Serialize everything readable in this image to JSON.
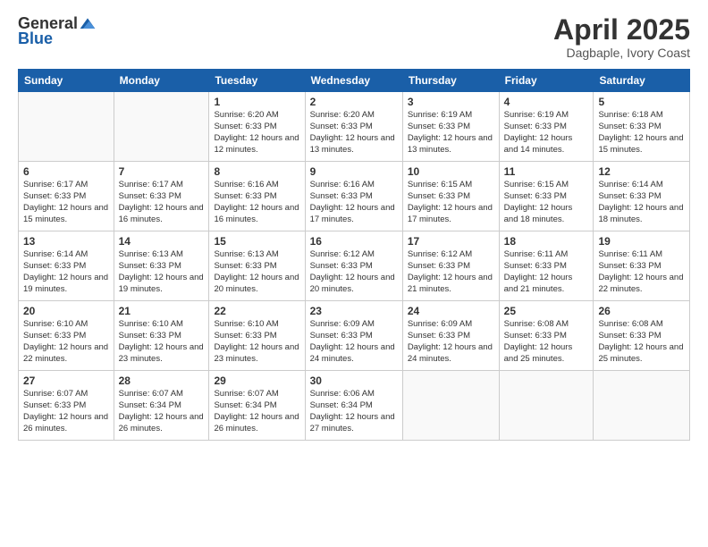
{
  "logo": {
    "general": "General",
    "blue": "Blue"
  },
  "header": {
    "month": "April 2025",
    "location": "Dagbaple, Ivory Coast"
  },
  "weekdays": [
    "Sunday",
    "Monday",
    "Tuesday",
    "Wednesday",
    "Thursday",
    "Friday",
    "Saturday"
  ],
  "weeks": [
    [
      {
        "day": null
      },
      {
        "day": null
      },
      {
        "day": "1",
        "sunrise": "6:20 AM",
        "sunset": "6:33 PM",
        "daylight": "12 hours and 12 minutes."
      },
      {
        "day": "2",
        "sunrise": "6:20 AM",
        "sunset": "6:33 PM",
        "daylight": "12 hours and 13 minutes."
      },
      {
        "day": "3",
        "sunrise": "6:19 AM",
        "sunset": "6:33 PM",
        "daylight": "12 hours and 13 minutes."
      },
      {
        "day": "4",
        "sunrise": "6:19 AM",
        "sunset": "6:33 PM",
        "daylight": "12 hours and 14 minutes."
      },
      {
        "day": "5",
        "sunrise": "6:18 AM",
        "sunset": "6:33 PM",
        "daylight": "12 hours and 15 minutes."
      }
    ],
    [
      {
        "day": "6",
        "sunrise": "6:17 AM",
        "sunset": "6:33 PM",
        "daylight": "12 hours and 15 minutes."
      },
      {
        "day": "7",
        "sunrise": "6:17 AM",
        "sunset": "6:33 PM",
        "daylight": "12 hours and 16 minutes."
      },
      {
        "day": "8",
        "sunrise": "6:16 AM",
        "sunset": "6:33 PM",
        "daylight": "12 hours and 16 minutes."
      },
      {
        "day": "9",
        "sunrise": "6:16 AM",
        "sunset": "6:33 PM",
        "daylight": "12 hours and 17 minutes."
      },
      {
        "day": "10",
        "sunrise": "6:15 AM",
        "sunset": "6:33 PM",
        "daylight": "12 hours and 17 minutes."
      },
      {
        "day": "11",
        "sunrise": "6:15 AM",
        "sunset": "6:33 PM",
        "daylight": "12 hours and 18 minutes."
      },
      {
        "day": "12",
        "sunrise": "6:14 AM",
        "sunset": "6:33 PM",
        "daylight": "12 hours and 18 minutes."
      }
    ],
    [
      {
        "day": "13",
        "sunrise": "6:14 AM",
        "sunset": "6:33 PM",
        "daylight": "12 hours and 19 minutes."
      },
      {
        "day": "14",
        "sunrise": "6:13 AM",
        "sunset": "6:33 PM",
        "daylight": "12 hours and 19 minutes."
      },
      {
        "day": "15",
        "sunrise": "6:13 AM",
        "sunset": "6:33 PM",
        "daylight": "12 hours and 20 minutes."
      },
      {
        "day": "16",
        "sunrise": "6:12 AM",
        "sunset": "6:33 PM",
        "daylight": "12 hours and 20 minutes."
      },
      {
        "day": "17",
        "sunrise": "6:12 AM",
        "sunset": "6:33 PM",
        "daylight": "12 hours and 21 minutes."
      },
      {
        "day": "18",
        "sunrise": "6:11 AM",
        "sunset": "6:33 PM",
        "daylight": "12 hours and 21 minutes."
      },
      {
        "day": "19",
        "sunrise": "6:11 AM",
        "sunset": "6:33 PM",
        "daylight": "12 hours and 22 minutes."
      }
    ],
    [
      {
        "day": "20",
        "sunrise": "6:10 AM",
        "sunset": "6:33 PM",
        "daylight": "12 hours and 22 minutes."
      },
      {
        "day": "21",
        "sunrise": "6:10 AM",
        "sunset": "6:33 PM",
        "daylight": "12 hours and 23 minutes."
      },
      {
        "day": "22",
        "sunrise": "6:10 AM",
        "sunset": "6:33 PM",
        "daylight": "12 hours and 23 minutes."
      },
      {
        "day": "23",
        "sunrise": "6:09 AM",
        "sunset": "6:33 PM",
        "daylight": "12 hours and 24 minutes."
      },
      {
        "day": "24",
        "sunrise": "6:09 AM",
        "sunset": "6:33 PM",
        "daylight": "12 hours and 24 minutes."
      },
      {
        "day": "25",
        "sunrise": "6:08 AM",
        "sunset": "6:33 PM",
        "daylight": "12 hours and 25 minutes."
      },
      {
        "day": "26",
        "sunrise": "6:08 AM",
        "sunset": "6:33 PM",
        "daylight": "12 hours and 25 minutes."
      }
    ],
    [
      {
        "day": "27",
        "sunrise": "6:07 AM",
        "sunset": "6:33 PM",
        "daylight": "12 hours and 26 minutes."
      },
      {
        "day": "28",
        "sunrise": "6:07 AM",
        "sunset": "6:34 PM",
        "daylight": "12 hours and 26 minutes."
      },
      {
        "day": "29",
        "sunrise": "6:07 AM",
        "sunset": "6:34 PM",
        "daylight": "12 hours and 26 minutes."
      },
      {
        "day": "30",
        "sunrise": "6:06 AM",
        "sunset": "6:34 PM",
        "daylight": "12 hours and 27 minutes."
      },
      {
        "day": null
      },
      {
        "day": null
      },
      {
        "day": null
      }
    ]
  ]
}
